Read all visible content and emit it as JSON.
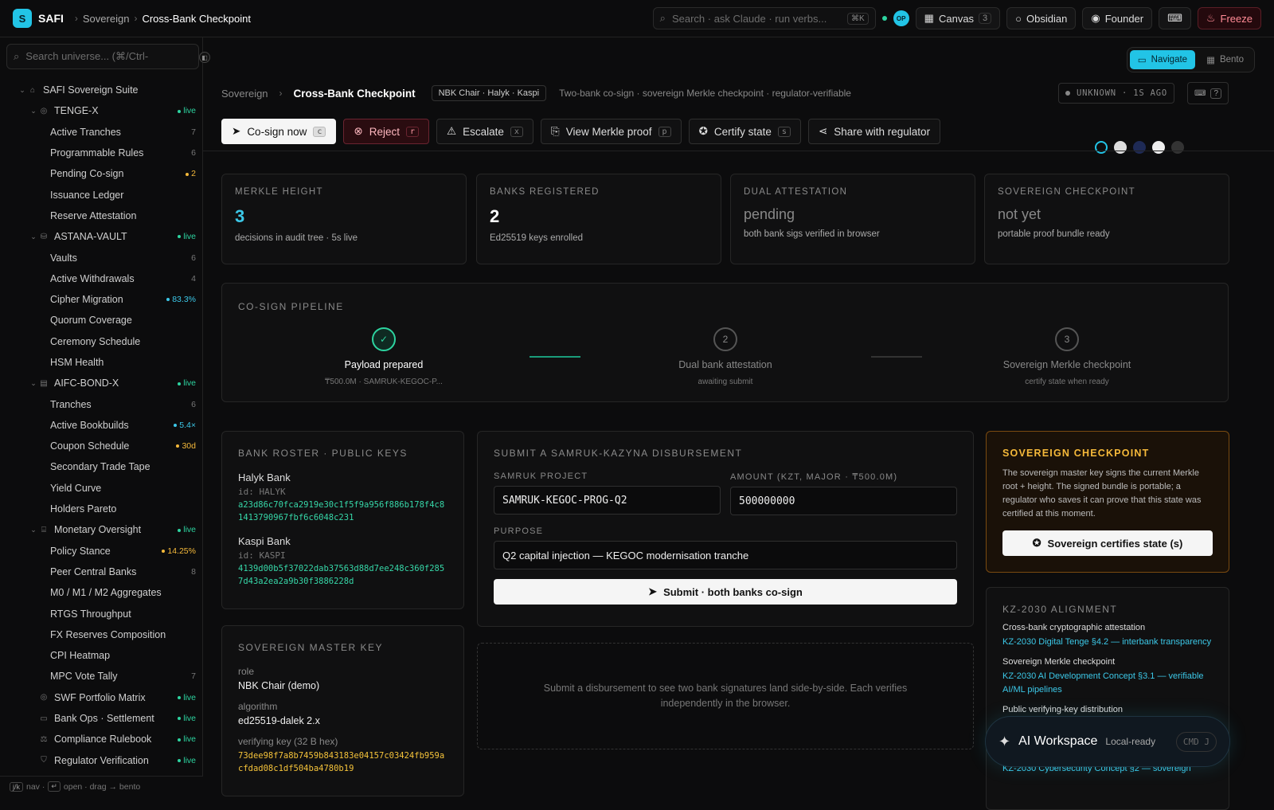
{
  "topbar": {
    "logo_letter": "S",
    "brand": "SAFI",
    "crumbs": [
      "Sovereign",
      "Cross-Bank Checkpoint"
    ],
    "search_placeholder": "Search · ask Claude · run verbs...",
    "search_kbd": "⌘K",
    "avatar": "OP",
    "canvas_label": "Canvas",
    "canvas_count": "3",
    "obsidian_label": "Obsidian",
    "founder_label": "Founder",
    "freeze_label": "Freeze"
  },
  "sidebar": {
    "search_placeholder": "Search universe... (⌘/Ctrl-",
    "footer": {
      "k1": "j/k",
      "t1": "nav ·",
      "k2": "↵",
      "t2": "open · drag → bento"
    },
    "items": [
      {
        "label": "SAFI Sovereign Suite",
        "level": 0,
        "chev": "⌄",
        "icon": "home-icon",
        "badge": ""
      },
      {
        "label": "TENGE-X",
        "level": 1,
        "chev": "⌄",
        "icon": "globe-icon",
        "badge": "live",
        "badge_type": "live"
      },
      {
        "label": "Active Tranches",
        "level": 2,
        "badge": "7"
      },
      {
        "label": "Programmable Rules",
        "level": 2,
        "badge": "6"
      },
      {
        "label": "Pending Co-sign",
        "level": 2,
        "badge": "2",
        "badge_type": "amber"
      },
      {
        "label": "Issuance Ledger",
        "level": 2,
        "badge": ""
      },
      {
        "label": "Reserve Attestation",
        "level": 2,
        "badge": ""
      },
      {
        "label": "ASTANA-VAULT",
        "level": 1,
        "chev": "⌄",
        "icon": "vault-icon",
        "badge": "live",
        "badge_type": "live"
      },
      {
        "label": "Vaults",
        "level": 2,
        "badge": "6"
      },
      {
        "label": "Active Withdrawals",
        "level": 2,
        "badge": "4"
      },
      {
        "label": "Cipher Migration",
        "level": 2,
        "badge": "83.3%",
        "badge_type": "cyan"
      },
      {
        "label": "Quorum Coverage",
        "level": 2,
        "badge": ""
      },
      {
        "label": "Ceremony Schedule",
        "level": 2,
        "badge": ""
      },
      {
        "label": "HSM Health",
        "level": 2,
        "badge": ""
      },
      {
        "label": "AIFC-BOND-X",
        "level": 1,
        "chev": "⌄",
        "icon": "document-icon",
        "badge": "live",
        "badge_type": "live"
      },
      {
        "label": "Tranches",
        "level": 2,
        "badge": "6"
      },
      {
        "label": "Active Bookbuilds",
        "level": 2,
        "badge": "5.4×",
        "badge_type": "cyan"
      },
      {
        "label": "Coupon Schedule",
        "level": 2,
        "badge": "30d",
        "badge_type": "amber"
      },
      {
        "label": "Secondary Trade Tape",
        "level": 2,
        "badge": ""
      },
      {
        "label": "Yield Curve",
        "level": 2,
        "badge": ""
      },
      {
        "label": "Holders Pareto",
        "level": 2,
        "badge": ""
      },
      {
        "label": "Monetary Oversight",
        "level": 1,
        "chev": "⌄",
        "icon": "bank-icon",
        "badge": "live",
        "badge_type": "live"
      },
      {
        "label": "Policy Stance",
        "level": 2,
        "badge": "14.25%",
        "badge_type": "amber"
      },
      {
        "label": "Peer Central Banks",
        "level": 2,
        "badge": "8"
      },
      {
        "label": "M0 / M1 / M2 Aggregates",
        "level": 2,
        "badge": ""
      },
      {
        "label": "RTGS Throughput",
        "level": 2,
        "badge": ""
      },
      {
        "label": "FX Reserves Composition",
        "level": 2,
        "badge": ""
      },
      {
        "label": "CPI Heatmap",
        "level": 2,
        "badge": ""
      },
      {
        "label": "MPC Vote Tally",
        "level": 2,
        "badge": "7"
      },
      {
        "label": "SWF Portfolio Matrix",
        "level": 1,
        "chev": "",
        "icon": "globe-icon",
        "badge": "live",
        "badge_type": "live"
      },
      {
        "label": "Bank Ops · Settlement",
        "level": 1,
        "chev": "",
        "icon": "card-icon",
        "badge": "live",
        "badge_type": "live"
      },
      {
        "label": "Compliance Rulebook",
        "level": 1,
        "chev": "",
        "icon": "gavel-icon",
        "badge": "live",
        "badge_type": "live"
      },
      {
        "label": "Regulator Verification",
        "level": 1,
        "chev": "",
        "icon": "shield-icon",
        "badge": "live",
        "badge_type": "live"
      }
    ]
  },
  "mode": {
    "navigate": "Navigate",
    "bento": "Bento"
  },
  "header": {
    "crumb1": "Sovereign",
    "crumb2": "Cross-Bank Checkpoint",
    "chip": "NBK Chair · Halyk · Kaspi",
    "desc": "Two-bank co-sign · sovereign Merkle checkpoint · regulator-verifiable",
    "status": "UNKNOWN · 1S AGO"
  },
  "actions": [
    {
      "label": "Co-sign now",
      "key": "c",
      "icon": "send-icon",
      "style": "primary"
    },
    {
      "label": "Reject",
      "key": "r",
      "icon": "x-circle-icon",
      "style": "danger"
    },
    {
      "label": "Escalate",
      "key": "x",
      "icon": "warning-icon",
      "style": ""
    },
    {
      "label": "View Merkle proof",
      "key": "p",
      "icon": "file-icon",
      "style": ""
    },
    {
      "label": "Certify state",
      "key": "s",
      "icon": "seal-icon",
      "style": ""
    },
    {
      "label": "Share with regulator",
      "key": "",
      "icon": "share-icon",
      "style": ""
    }
  ],
  "stats": [
    {
      "title": "MERKLE HEIGHT",
      "value": "3",
      "sub": "decisions in audit tree · 5s live",
      "color": "#3cc8e8"
    },
    {
      "title": "BANKS REGISTERED",
      "value": "2",
      "sub": "Ed25519 keys enrolled",
      "color": "#ffffff"
    },
    {
      "title": "DUAL ATTESTATION",
      "value": "pending",
      "sub": "both bank sigs verified in browser",
      "color": "#888888"
    },
    {
      "title": "SOVEREIGN CHECKPOINT",
      "value": "not yet",
      "sub": "portable proof bundle ready",
      "color": "#888888"
    }
  ],
  "pipeline": {
    "title": "CO-SIGN PIPELINE",
    "steps": [
      {
        "num": "✓",
        "name": "Payload prepared",
        "sub": "₸500.0M · SAMRUK-KEGOC-P...",
        "done": true
      },
      {
        "num": "2",
        "name": "Dual bank attestation",
        "sub": "awaiting submit",
        "done": false
      },
      {
        "num": "3",
        "name": "Sovereign Merkle checkpoint",
        "sub": "certify state when ready",
        "done": false
      }
    ]
  },
  "roster": {
    "title": "BANK ROSTER · PUBLIC KEYS",
    "banks": [
      {
        "name": "Halyk Bank",
        "id": "id: HALYK",
        "key": "a23d86c70fca2919e30c1f5f9a956f886b178f4c81413790967fbf6c6048c231"
      },
      {
        "name": "Kaspi Bank",
        "id": "id: KASPI",
        "key": "4139d00b5f37022dab37563d88d7ee248c360f2857d43a2ea2a9b30f3886228d"
      }
    ]
  },
  "master_key": {
    "title": "SOVEREIGN MASTER KEY",
    "role_label": "role",
    "role": "NBK Chair (demo)",
    "algo_label": "algorithm",
    "algo": "ed25519-dalek 2.x",
    "vk_label": "verifying key (32 B hex)",
    "vk": "73dee98f7a8b7459b843183e04157c03424fb959acfdad08c1df504ba4780b19"
  },
  "form": {
    "title": "SUBMIT A SAMRUK-KAZYNA DISBURSEMENT",
    "project_label": "SAMRUK PROJECT",
    "project_value": "SAMRUK-KEGOC-PROG-Q2",
    "amount_label": "AMOUNT (KZT, MAJOR · ₸500.0M)",
    "amount_value": "500000000",
    "purpose_label": "PURPOSE",
    "purpose_value": "Q2 capital injection — KEGOC modernisation tranche",
    "submit": "Submit · both banks co-sign"
  },
  "empty_text": "Submit a disbursement to see two bank signatures land side-by-side. Each verifies independently in the browser.",
  "sov_cp": {
    "title": "SOVEREIGN CHECKPOINT",
    "desc": "The sovereign master key signs the current Merkle root + height. The signed bundle is portable; a regulator who saves it can prove that this state was certified at this moment.",
    "button": "Sovereign certifies state (s)"
  },
  "kz": {
    "title": "KZ-2030 ALIGNMENT",
    "items": [
      {
        "item": "Cross-bank cryptographic attestation",
        "link": "KZ-2030 Digital Tenge §4.2 — interbank transparency"
      },
      {
        "item": "Sovereign Merkle checkpoint",
        "link": "KZ-2030 AI Development Concept §3.1 — verifiable AI/ML pipelines"
      },
      {
        "item": "Public verifying-key distribution",
        "link": "KZ-2030 Cybersecurity Concept §2 — sovereign"
      }
    ]
  },
  "ai": {
    "name": "AI Workspace",
    "status": "Local-ready",
    "cmd": "CMD J"
  }
}
